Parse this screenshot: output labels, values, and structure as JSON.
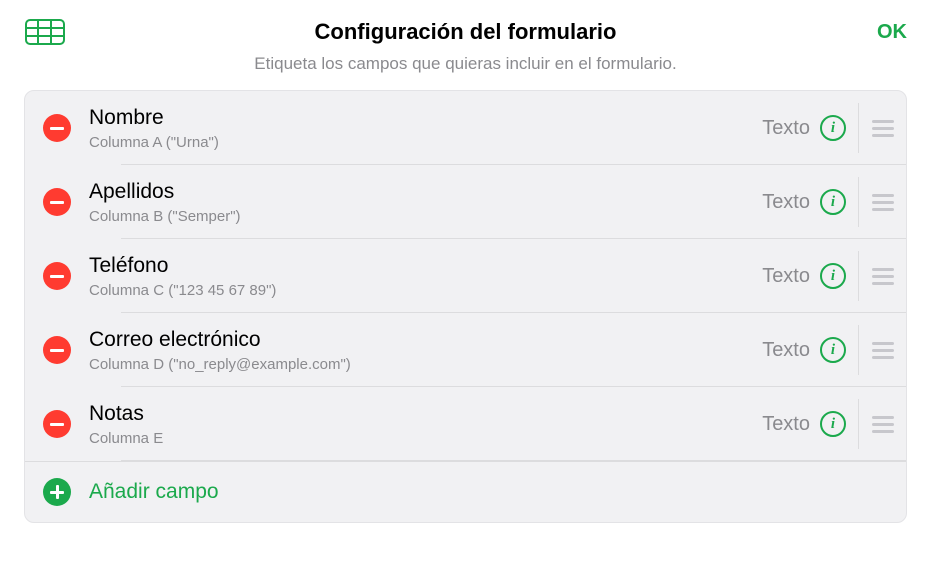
{
  "header": {
    "title": "Configuración del formulario",
    "ok_label": "OK"
  },
  "subtitle": "Etiqueta los campos que quieras incluir en el formulario.",
  "type_label": "Texto",
  "add_label": "Añadir campo",
  "fields": [
    {
      "name": "Nombre",
      "column": "Columna A (\"Urna\")"
    },
    {
      "name": "Apellidos",
      "column": "Columna B (\"Semper\")"
    },
    {
      "name": "Teléfono",
      "column": "Columna C (\"123 45 67 89\")"
    },
    {
      "name": "Correo electrónico",
      "column": "Columna D (\"no_reply@example.com\")"
    },
    {
      "name": "Notas",
      "column": "Columna E"
    }
  ]
}
